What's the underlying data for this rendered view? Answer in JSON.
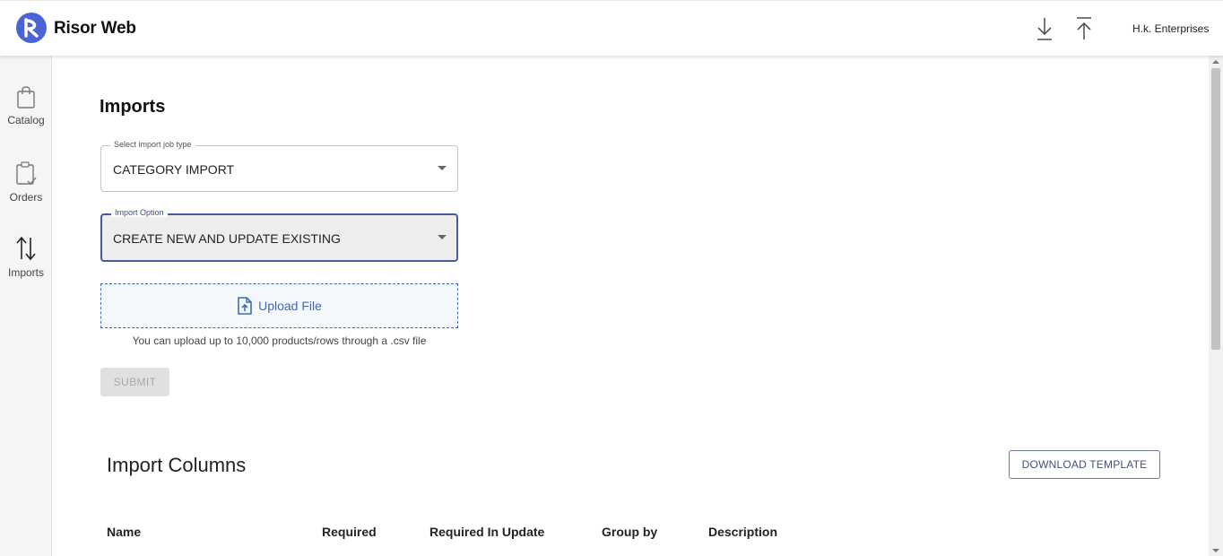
{
  "header": {
    "app_title": "Risor Web",
    "download_icon": "download-icon",
    "upload_icon": "upload-icon",
    "company": "H.k. Enterprises"
  },
  "sidebar": {
    "items": [
      {
        "label": "Catalog",
        "icon": "shopping-bag-icon"
      },
      {
        "label": "Orders",
        "icon": "clipboard-check-icon"
      },
      {
        "label": "Imports",
        "icon": "swap-vertical-icon",
        "active": true
      }
    ]
  },
  "main": {
    "title": "Imports",
    "job_type": {
      "label": "Select import job type",
      "value": "CATEGORY IMPORT"
    },
    "import_option": {
      "label": "Import Option",
      "value": "CREATE NEW AND UPDATE EXISTING"
    },
    "upload": {
      "label": "Upload File",
      "hint": "You can upload up to 10,000 products/rows through a .csv file"
    },
    "submit_label": "SUBMIT"
  },
  "import_columns": {
    "title": "Import Columns",
    "download_template_label": "DOWNLOAD TEMPLATE",
    "headers": [
      "Name",
      "Required",
      "Required In Update",
      "Group by",
      "Description"
    ]
  },
  "colors": {
    "brand": "#4a64d8",
    "focus_border": "#4a5a9e",
    "upload_accent": "#3d6bb3",
    "disabled_bg": "#e0e0e0"
  }
}
